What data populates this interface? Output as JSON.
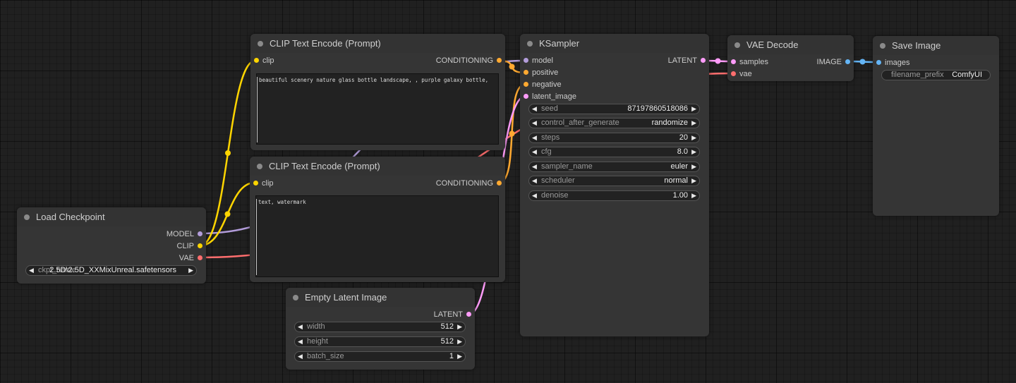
{
  "colors": {
    "model": "#b39ddb",
    "clip": "#ffd500",
    "vae": "#ff6e6e",
    "conditioning": "#ffa931",
    "latent": "#ff9cf9",
    "image": "#64b5f6"
  },
  "load_checkpoint": {
    "title": "Load Checkpoint",
    "outputs": [
      "MODEL",
      "CLIP",
      "VAE"
    ],
    "ckpt_name_label": "ckpt_name",
    "ckpt_name_value": "2.5D\\2.5D_XXMixUnreal.safetensors"
  },
  "clip_pos": {
    "title": "CLIP Text Encode (Prompt)",
    "input": "clip",
    "output": "CONDITIONING",
    "text": "beautiful scenery nature glass bottle landscape, , purple galaxy bottle,"
  },
  "clip_neg": {
    "title": "CLIP Text Encode (Prompt)",
    "input": "clip",
    "output": "CONDITIONING",
    "text": "text, watermark"
  },
  "empty_latent": {
    "title": "Empty Latent Image",
    "output": "LATENT",
    "widgets": [
      {
        "name": "width",
        "value": "512"
      },
      {
        "name": "height",
        "value": "512"
      },
      {
        "name": "batch_size",
        "value": "1"
      }
    ]
  },
  "ksampler": {
    "title": "KSampler",
    "inputs": [
      "model",
      "positive",
      "negative",
      "latent_image"
    ],
    "output": "LATENT",
    "widgets": [
      {
        "name": "seed",
        "value": "87197860518086"
      },
      {
        "name": "control_after_generate",
        "value": "randomize"
      },
      {
        "name": "steps",
        "value": "20"
      },
      {
        "name": "cfg",
        "value": "8.0"
      },
      {
        "name": "sampler_name",
        "value": "euler"
      },
      {
        "name": "scheduler",
        "value": "normal"
      },
      {
        "name": "denoise",
        "value": "1.00"
      }
    ]
  },
  "vae_decode": {
    "title": "VAE Decode",
    "inputs": [
      "samples",
      "vae"
    ],
    "output": "IMAGE"
  },
  "save_image": {
    "title": "Save Image",
    "input": "images",
    "filename_prefix_label": "filename_prefix",
    "filename_prefix_value": "ComfyUI"
  }
}
